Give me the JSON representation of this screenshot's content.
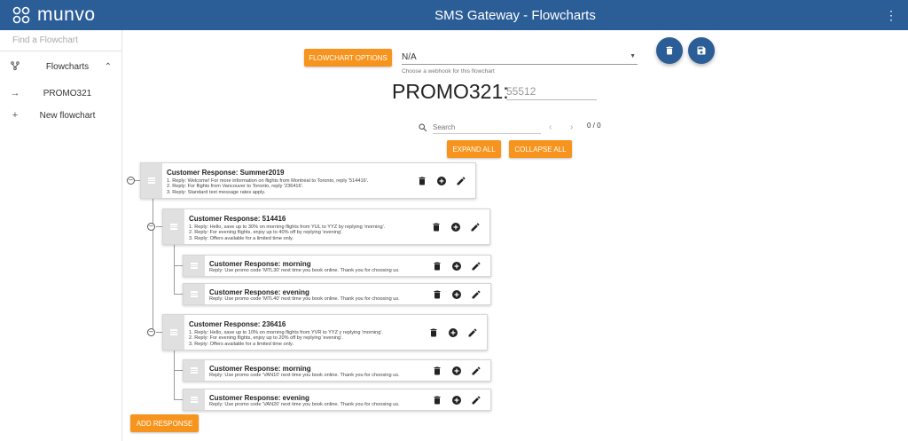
{
  "brand": {
    "name": "munvo"
  },
  "appbar": {
    "title": "SMS Gateway - Flowcharts"
  },
  "sidebar": {
    "search_placeholder": "Find a Flowchart",
    "items": [
      {
        "label": "Flowcharts"
      },
      {
        "label": "PROMO321"
      },
      {
        "label": "New flowchart"
      }
    ]
  },
  "toolbar": {
    "flowchart_options": "FLOWCHART OPTIONS",
    "webhook_value": "N/A",
    "webhook_hint": "Choose a webhook for this flowchart"
  },
  "flowchart": {
    "title": "PROMO321:",
    "code": "55512"
  },
  "search": {
    "placeholder": "Search",
    "counter": "0 / 0"
  },
  "buttons": {
    "expand_all": "EXPAND ALL",
    "collapse_all": "COLLAPSE ALL",
    "add_response": "ADD RESPONSE"
  },
  "nodes": [
    {
      "title": "Customer Response: Summer2019",
      "lines": [
        "1. Reply: Welcome! For more information on flights from Montreal to Toronto, reply '514416'.",
        "2. Reply: For flights from Vancouver to Toronto, reply '236416'.",
        "3. Reply: Standard text message rates apply."
      ]
    },
    {
      "title": "Customer Response: 514416",
      "lines": [
        "1. Reply: Hello, save up to 30% on morning flights from YUL to YYZ by replying 'morning'.",
        "2. Reply: For evening flights, enjoy up to 40% off by replying 'evening'.",
        "3. Reply: Offers available for a limited time only."
      ]
    },
    {
      "title": "Customer Response: morning",
      "lines": [
        "Reply: Use promo code 'MTL30' next time you book online. Thank you for choosing us."
      ]
    },
    {
      "title": "Customer Response: evening",
      "lines": [
        "Reply: Use promo code 'MTL40' next time you book online. Thank you for choosing us."
      ]
    },
    {
      "title": "Customer Response: 236416",
      "lines": [
        "1. Reply: Hello, save up to 10% on morning flights from YVR to YYZ y replying 'morning'.",
        "2. Reply: For evening flights, enjoy up to 20% off by replying 'evening'.",
        "3. Reply: Offers available for a limited time only."
      ]
    },
    {
      "title": "Customer Response: morning",
      "lines": [
        "Reply: Use promo code 'VAN10' next time you book online. Thank you for choosing us."
      ]
    },
    {
      "title": "Customer Response: evening",
      "lines": [
        "Reply: Use promo code 'VAN20' next time you book online. Thank you for choosing us."
      ]
    }
  ],
  "icons": {
    "logo": "munvo-logo-icon",
    "kebab": "more-vert-icon",
    "tree": "account-tree-icon",
    "delete": "delete-icon",
    "add": "add-circle-icon",
    "edit": "edit-icon",
    "save": "save-icon",
    "search": "search-icon"
  },
  "colors": {
    "brand_blue": "#2b5d97",
    "accent_orange": "#f7941d"
  }
}
